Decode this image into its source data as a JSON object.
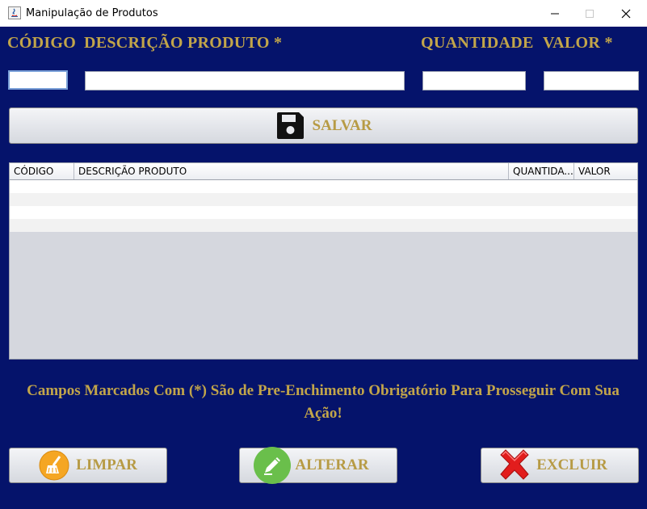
{
  "window": {
    "title": "Manipulação de Produtos"
  },
  "form": {
    "labels": {
      "codigo": "CÓDIGO",
      "descricao": "DESCRIÇÃO PRODUTO *",
      "quantidade": "QUANTIDADE",
      "valor": "VALOR *"
    },
    "values": {
      "codigo": "",
      "descricao": "",
      "quantidade": "",
      "valor": ""
    }
  },
  "buttons": {
    "salvar": {
      "label": "SALVAR",
      "icon": "floppy-disk-icon"
    },
    "limpar": {
      "label": "LIMPAR",
      "icon": "broom-icon"
    },
    "alterar": {
      "label": "ALTERAR",
      "icon": "pencil-icon"
    },
    "excluir": {
      "label": "EXCLUIR",
      "icon": "red-x-icon"
    }
  },
  "table": {
    "columns": [
      "CÓDIGO",
      "DESCRIÇÃO PRODUTO",
      "QUANTIDA...",
      "VALOR"
    ],
    "rows": []
  },
  "notice": "Campos Marcados Com (*) São de Pre-Enchimento Obrigatório Para Prosseguir Com Sua Ação!",
  "colors": {
    "background": "#05136b",
    "label": "#c2a54a",
    "button_text": "#b79b45"
  }
}
